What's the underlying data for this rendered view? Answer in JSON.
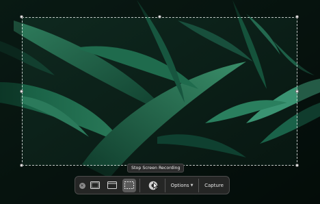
{
  "tooltip": {
    "text": "Stop Screen Recording"
  },
  "toolbar": {
    "close_icon": "close-icon",
    "buttons": [
      {
        "name": "record-entire-screen",
        "icon": "screen-icon"
      },
      {
        "name": "record-selected-window",
        "icon": "window-icon"
      },
      {
        "name": "record-selected-portion",
        "icon": "dashed-selection-icon",
        "selected": true
      },
      {
        "name": "stop-recording",
        "icon": "stop-recording-icon"
      }
    ],
    "options_label": "Options",
    "capture_label": "Capture"
  },
  "colors": {
    "leaf_dark": "#0d3a2b",
    "leaf_light": "#2f7f5e",
    "toolbar_bg": "#282828"
  }
}
